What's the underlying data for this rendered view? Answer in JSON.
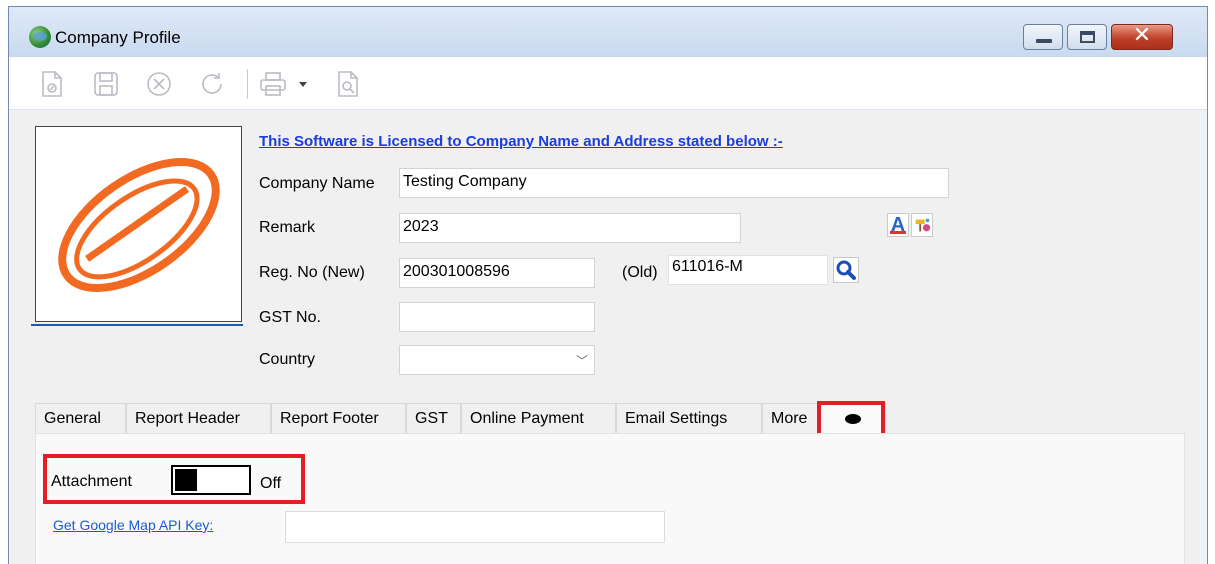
{
  "window": {
    "title": "Company Profile"
  },
  "toolbar": {
    "buttons": [
      "new-icon",
      "save-icon",
      "cancel-icon",
      "refresh-icon",
      "print-icon",
      "dropdown-arrow-icon",
      "preview-icon"
    ]
  },
  "header": {
    "license_text": "This Software is Licensed to Company Name and Address stated below :-"
  },
  "form": {
    "company_name_label": "Company Name",
    "company_name_value": "Testing Company",
    "remark_label": "Remark",
    "remark_value": "2023",
    "reg_new_label": "Reg. No (New)",
    "reg_new_value": "200301008596",
    "reg_old_label": "(Old)",
    "reg_old_value": "611016-M",
    "gst_label": "GST No.",
    "gst_value": "",
    "country_label": "Country",
    "country_value": ""
  },
  "tabs": [
    {
      "label": "General"
    },
    {
      "label": "Report Header"
    },
    {
      "label": "Report Footer"
    },
    {
      "label": "GST"
    },
    {
      "label": "Online Payment"
    },
    {
      "label": "Email Settings"
    },
    {
      "label": "More"
    },
    {
      "label": ""
    }
  ],
  "panel": {
    "attachment_label": "Attachment",
    "attachment_state": "Off",
    "map_link": "Get Google Map API Key:",
    "map_key_value": ""
  },
  "colors": {
    "highlight": "#e31e24",
    "link": "#1a3ce0",
    "logo_orange": "#f26a21"
  }
}
